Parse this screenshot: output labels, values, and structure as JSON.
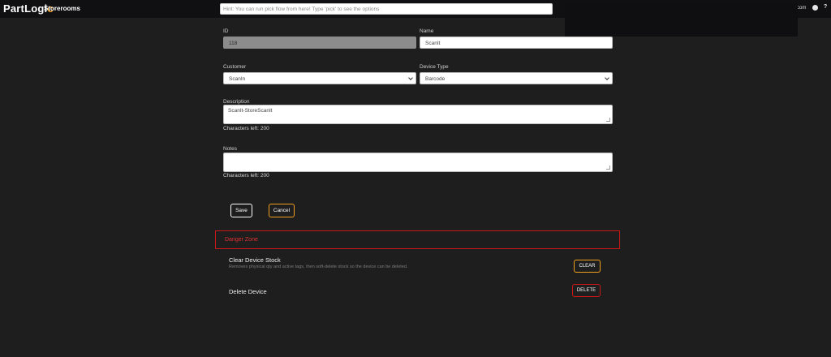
{
  "topbar": {
    "logo_main": "PartLogi",
    "logo_accent": "c",
    "nav_label": "Storerooms",
    "search_placeholder": "Hint: You can run pick flow from here! Type 'pick' to see the options",
    "user_label": "com",
    "help_label": "?"
  },
  "form": {
    "id_label": "ID",
    "id_value": "118",
    "name_label": "Name",
    "name_value": "ScanIt",
    "customer_label": "Customer",
    "customer_value": "ScanIn",
    "device_type_label": "Device Type",
    "device_type_value": "Barcode",
    "description_label": "Description",
    "description_value": "ScanIt-StoreScanIt",
    "description_chars_left": "Characters left: 200",
    "notes_label": "Notes",
    "notes_value": "",
    "notes_chars_left": "Characters left: 200",
    "save_label": "Save",
    "cancel_label": "Cancel"
  },
  "danger_zone": {
    "title": "Danger Zone",
    "clear_title": "Clear Device Stock",
    "clear_desc": "Removes physical qty and active tags, then soft-delete stock so the device can be deleted.",
    "clear_button": "CLEAR",
    "delete_title": "Delete Device",
    "delete_button": "DELETE"
  },
  "colors": {
    "background": "#1e1e1e",
    "accent": "#f0a020",
    "danger": "#c81818"
  }
}
